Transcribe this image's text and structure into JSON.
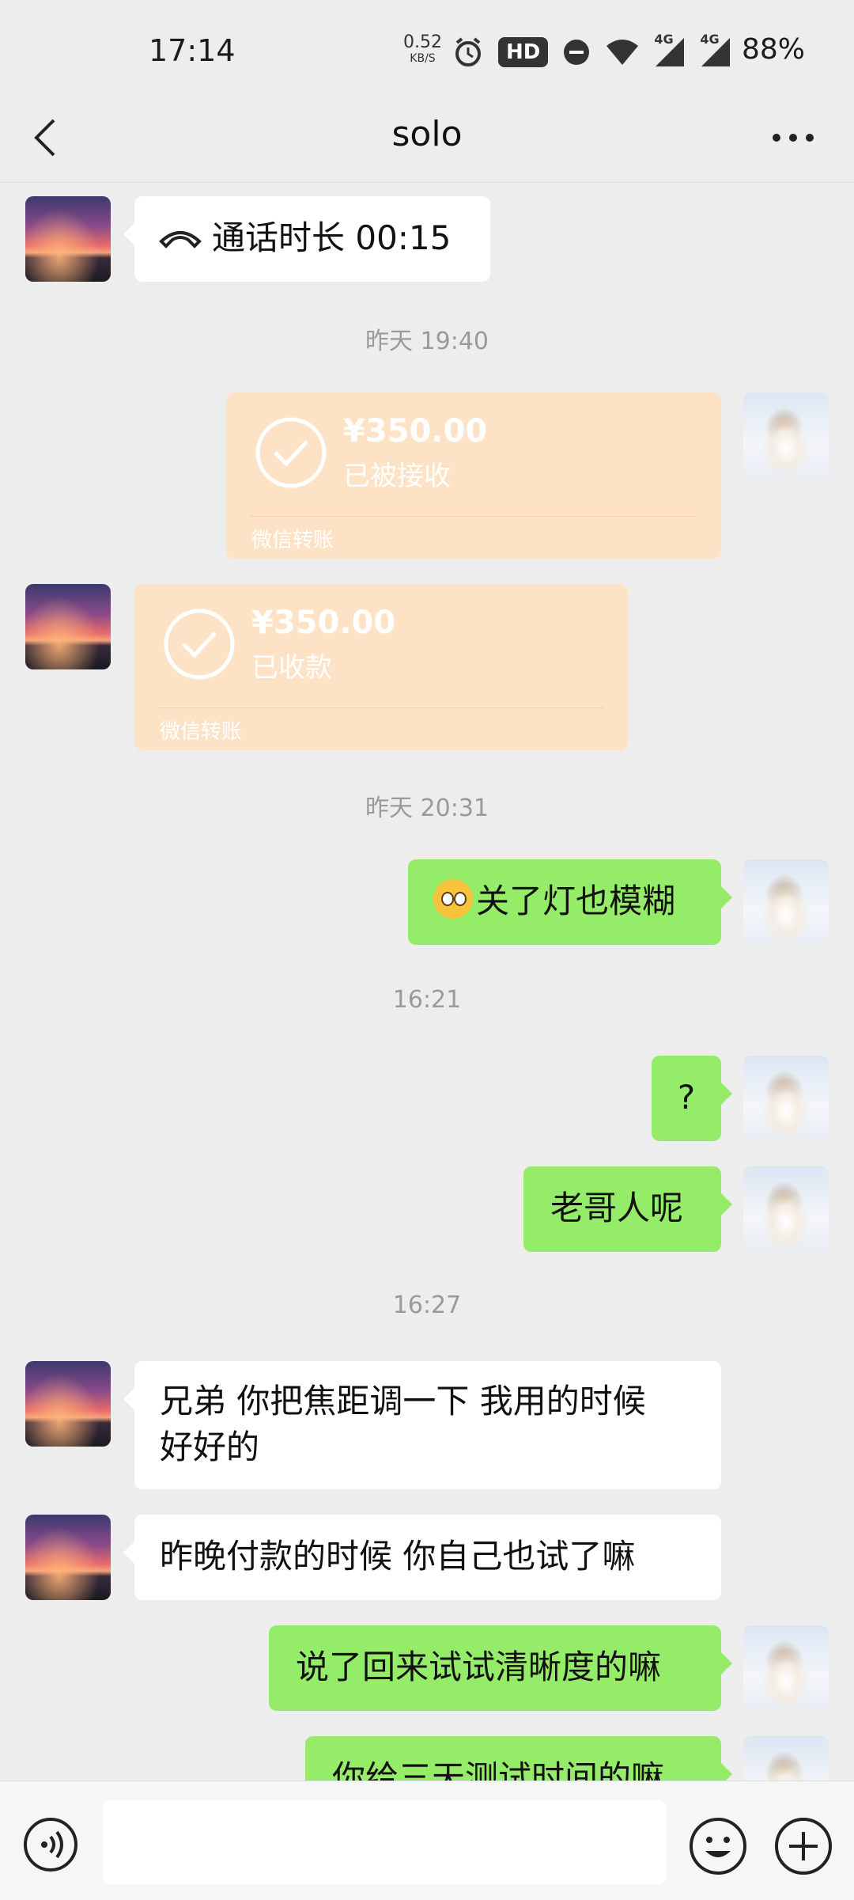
{
  "status_bar": {
    "time": "17:14",
    "net_speed": "0.52",
    "net_unit": "KB/S",
    "hd_badge": "HD",
    "signal_1": "4G",
    "signal_2": "4G",
    "battery": "88%"
  },
  "header": {
    "title": "solo"
  },
  "messages": {
    "call": {
      "text": "通话时长 00:15"
    },
    "ts1": "昨天 19:40",
    "transfer_sent": {
      "amount": "¥350.00",
      "status": "已被接收",
      "source": "微信转账"
    },
    "transfer_received": {
      "amount": "¥350.00",
      "status": "已收款",
      "source": "微信转账"
    },
    "ts2": "昨天 20:31",
    "m1": "关了灯也模糊",
    "ts3": "16:21",
    "m2": "?",
    "m3": "老哥人呢",
    "ts4": "16:27",
    "m4_line1": "兄弟 你把焦距调一下  我用的时候",
    "m4_line2": "好好的",
    "m5": "昨晚付款的时候  你自己也试了嘛",
    "m6": "说了回来试试清晰度的嘛",
    "m7": "你给三天测试时间的嘛"
  },
  "colors": {
    "background": "#ededed",
    "sent_bubble": "#95ec69",
    "received_bubble": "#ffffff",
    "transfer_card": "#fde2c6"
  },
  "icons": [
    "back-arrow-icon",
    "more-icon",
    "alarm-icon",
    "dnd-icon",
    "wifi-icon",
    "signal-icon",
    "hangup-icon",
    "check-circle-icon",
    "voice-icon",
    "emoji-icon",
    "plus-icon"
  ]
}
